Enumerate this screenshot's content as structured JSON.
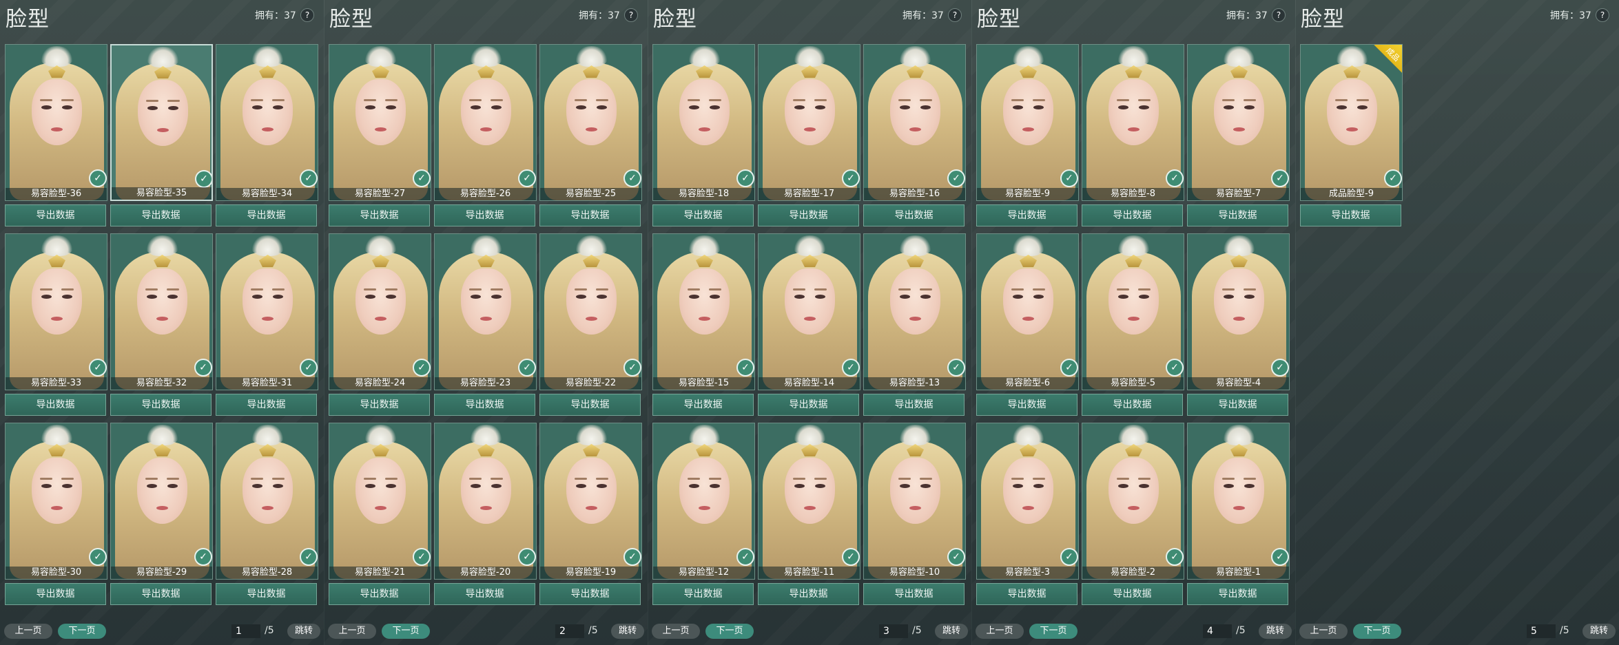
{
  "panels": [
    {
      "title": "脸型",
      "owned": "拥有：37",
      "help": "?",
      "page": "1",
      "total": "/5",
      "prev": "上一页",
      "next": "下一页",
      "jump": "跳转",
      "selected": 1,
      "items": [
        "易容脸型-36",
        "易容脸型-35",
        "易容脸型-34",
        "易容脸型-33",
        "易容脸型-32",
        "易容脸型-31",
        "易容脸型-30",
        "易容脸型-29",
        "易容脸型-28"
      ]
    },
    {
      "title": "脸型",
      "owned": "拥有：37",
      "help": "?",
      "page": "2",
      "total": "/5",
      "prev": "上一页",
      "next": "下一页",
      "jump": "跳转",
      "selected": -1,
      "items": [
        "易容脸型-27",
        "易容脸型-26",
        "易容脸型-25",
        "易容脸型-24",
        "易容脸型-23",
        "易容脸型-22",
        "易容脸型-21",
        "易容脸型-20",
        "易容脸型-19"
      ]
    },
    {
      "title": "脸型",
      "owned": "拥有：37",
      "help": "?",
      "page": "3",
      "total": "/5",
      "prev": "上一页",
      "next": "下一页",
      "jump": "跳转",
      "selected": -1,
      "items": [
        "易容脸型-18",
        "易容脸型-17",
        "易容脸型-16",
        "易容脸型-15",
        "易容脸型-14",
        "易容脸型-13",
        "易容脸型-12",
        "易容脸型-11",
        "易容脸型-10"
      ]
    },
    {
      "title": "脸型",
      "owned": "拥有：37",
      "help": "?",
      "page": "4",
      "total": "/5",
      "prev": "上一页",
      "next": "下一页",
      "jump": "跳转",
      "selected": -1,
      "items": [
        "易容脸型-9",
        "易容脸型-8",
        "易容脸型-7",
        "易容脸型-6",
        "易容脸型-5",
        "易容脸型-4",
        "易容脸型-3",
        "易容脸型-2",
        "易容脸型-1"
      ]
    },
    {
      "title": "脸型",
      "owned": "拥有：37",
      "help": "?",
      "page": "5",
      "total": "/5",
      "prev": "上一页",
      "next": "下一页",
      "jump": "跳转",
      "selected": -1,
      "items": [
        "成品脸型-9"
      ],
      "badge": "成品"
    }
  ],
  "export_label": "导出数据",
  "check_glyph": "✓",
  "colors": {
    "card_bg": "#3c6d62",
    "button_bg": "#2f6659",
    "accent": "#3d8c7c",
    "badge": "#f2d232"
  }
}
